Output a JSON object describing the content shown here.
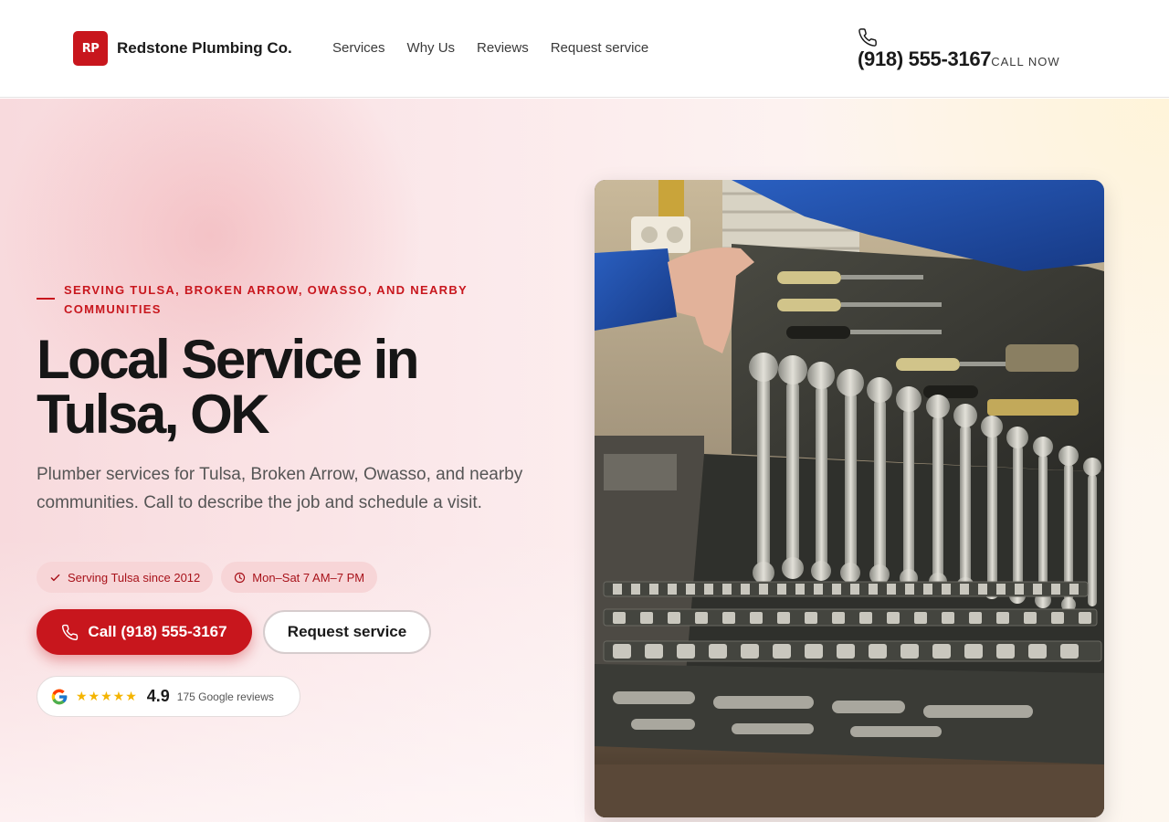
{
  "brand": {
    "initials": "RP",
    "name": "Redstone Plumbing Co.",
    "color": "#c8161d"
  },
  "nav": {
    "items": [
      {
        "label": "Services"
      },
      {
        "label": "Why Us"
      },
      {
        "label": "Reviews"
      },
      {
        "label": "Request service"
      }
    ]
  },
  "header_phone": {
    "icon": "phone-icon",
    "number": "(918) 555-3167",
    "cta": "CALL NOW"
  },
  "hero": {
    "eyebrow": "Serving Tulsa, Broken Arrow, Owasso, and nearby communities",
    "title": "Local Service in Tulsa, OK",
    "description": "Plumber services for Tulsa, Broken Arrow, Owasso, and nearby communities. Call to describe the job and schedule a visit.",
    "badges": [
      {
        "icon": "check-icon",
        "label": "Serving Tulsa since 2012"
      },
      {
        "icon": "clock-icon",
        "label": "Mon–Sat 7 AM–7 PM"
      }
    ],
    "call_button": {
      "icon": "phone-icon",
      "label": "Call (918) 555-3167"
    },
    "request_button": {
      "label": "Request service"
    },
    "rating": {
      "icon": "google-icon",
      "stars": "★★★★★",
      "score": "4.9",
      "reviews": "175 Google reviews"
    },
    "image": {
      "subject": "toolbox-with-wrenches-photo"
    }
  }
}
